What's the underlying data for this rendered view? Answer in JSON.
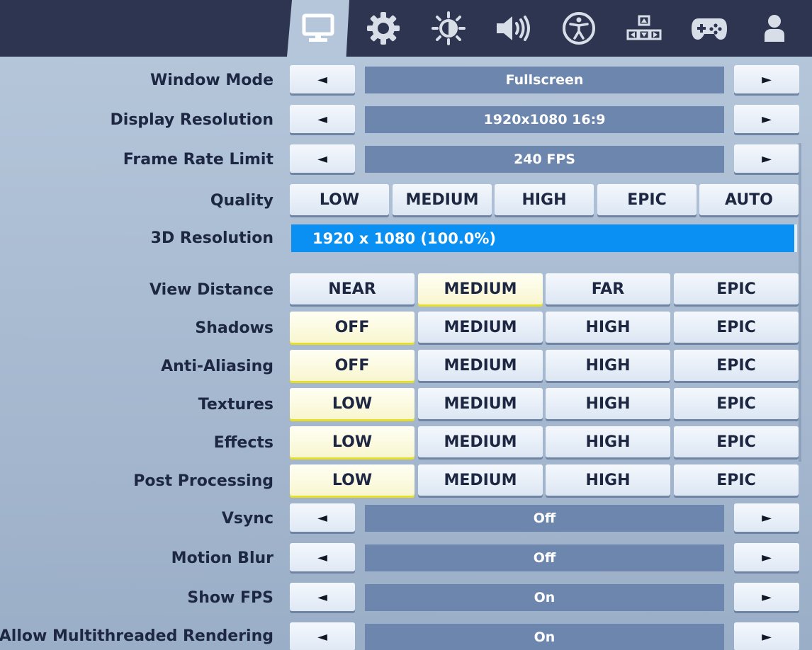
{
  "tabs": [
    {
      "icon": "monitor-icon",
      "active": true
    },
    {
      "icon": "gear-icon",
      "active": false
    },
    {
      "icon": "brightness-icon",
      "active": false
    },
    {
      "icon": "speaker-icon",
      "active": false
    },
    {
      "icon": "accessibility-icon",
      "active": false
    },
    {
      "icon": "input-keys-icon",
      "active": false
    },
    {
      "icon": "gamepad-icon",
      "active": false
    },
    {
      "icon": "account-icon",
      "active": false
    }
  ],
  "colors": {
    "topbar": "#2e3551",
    "value_box": "#6c86ad",
    "slider_fill": "#0a8ff2",
    "selected_underline": "#e7de2a"
  },
  "arrows": {
    "left": "◄",
    "right": "►"
  },
  "settings": {
    "window_mode": {
      "label": "Window Mode",
      "value": "Fullscreen"
    },
    "display_resolution": {
      "label": "Display Resolution",
      "value": "1920x1080 16:9"
    },
    "frame_rate_limit": {
      "label": "Frame Rate Limit",
      "value": "240 FPS"
    },
    "quality": {
      "label": "Quality",
      "options": [
        "LOW",
        "MEDIUM",
        "HIGH",
        "EPIC",
        "AUTO"
      ]
    },
    "resolution_3d": {
      "label": "3D Resolution",
      "value": "1920 x 1080 (100.0%)",
      "percent": 100.0
    },
    "view_distance": {
      "label": "View Distance",
      "options": [
        "NEAR",
        "MEDIUM",
        "FAR",
        "EPIC"
      ],
      "selected": "MEDIUM"
    },
    "shadows": {
      "label": "Shadows",
      "options": [
        "OFF",
        "MEDIUM",
        "HIGH",
        "EPIC"
      ],
      "selected": "OFF"
    },
    "anti_aliasing": {
      "label": "Anti-Aliasing",
      "options": [
        "OFF",
        "MEDIUM",
        "HIGH",
        "EPIC"
      ],
      "selected": "OFF"
    },
    "textures": {
      "label": "Textures",
      "options": [
        "LOW",
        "MEDIUM",
        "HIGH",
        "EPIC"
      ],
      "selected": "LOW"
    },
    "effects": {
      "label": "Effects",
      "options": [
        "LOW",
        "MEDIUM",
        "HIGH",
        "EPIC"
      ],
      "selected": "LOW"
    },
    "post_processing": {
      "label": "Post Processing",
      "options": [
        "LOW",
        "MEDIUM",
        "HIGH",
        "EPIC"
      ],
      "selected": "LOW"
    },
    "vsync": {
      "label": "Vsync",
      "value": "Off"
    },
    "motion_blur": {
      "label": "Motion Blur",
      "value": "Off"
    },
    "show_fps": {
      "label": "Show FPS",
      "value": "On"
    },
    "multithreaded": {
      "label": "Allow Multithreaded Rendering",
      "value": "On"
    }
  }
}
